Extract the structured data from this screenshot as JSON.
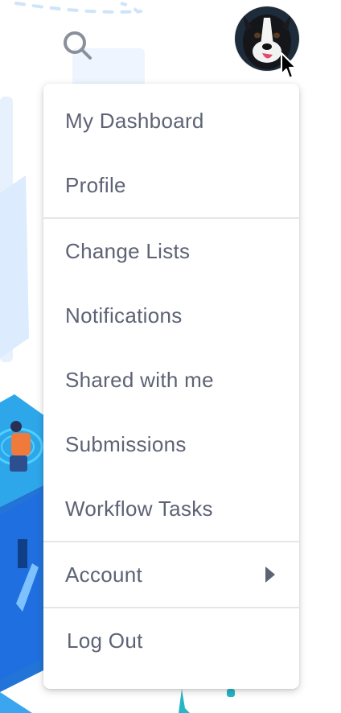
{
  "header": {
    "search_icon": "search-icon",
    "avatar_alt": "User avatar (dog photo)"
  },
  "menu": {
    "sections": [
      {
        "items": [
          {
            "label": "My Dashboard"
          },
          {
            "label": "Profile"
          }
        ]
      },
      {
        "items": [
          {
            "label": "Change Lists"
          },
          {
            "label": "Notifications"
          },
          {
            "label": "Shared with me"
          },
          {
            "label": "Submissions"
          },
          {
            "label": "Workflow Tasks"
          }
        ]
      },
      {
        "items": [
          {
            "label": "Account",
            "submenu_icon": "caret-right-icon"
          }
        ]
      },
      {
        "items": [
          {
            "label": "Log Out"
          }
        ]
      }
    ]
  },
  "colors": {
    "menu_text": "#5d6375",
    "divider": "#e4e6ea",
    "icon_gray": "#8a8f99",
    "illustration_blue": "#2f7de1",
    "illustration_light": "#dcecff"
  }
}
